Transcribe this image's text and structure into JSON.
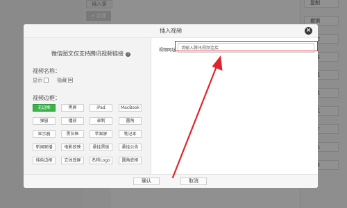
{
  "background": {
    "top_button": "插入录",
    "new_button": "+ 新建",
    "side_buttons": [
      "复制",
      "撤销",
      "清空",
      "本格",
      "恢复",
      "预览",
      "手机",
      "同步",
      "导出",
      "保存"
    ]
  },
  "modal": {
    "title": "插入视频",
    "close_icon": "close-icon",
    "notice": "微信图文仅支持腾讯视频链接",
    "help_icon": "?",
    "video_name_label": "视频名称：",
    "show_label": "显示",
    "hide_label": "隐藏",
    "show_checked": false,
    "hide_checked": true,
    "border_label": "视频边框：",
    "border_styles": [
      [
        "无边框",
        "黑屏",
        "iPad",
        "MacBook"
      ],
      [
        "弹窗",
        "播放",
        "录制",
        "圆角"
      ],
      [
        "显示器",
        "黑灰框",
        "苹果屏",
        "笔记本"
      ],
      [
        "新闻联播",
        "电影放映",
        "悬挂黑板",
        "悬挂公告"
      ],
      [
        "纯色边框",
        "立体遥屏",
        "名称Logo",
        "圆角底框"
      ]
    ],
    "selected_border": "无边框",
    "url_label": "视频网址",
    "url_placeholder": "请输入腾讯视频连接",
    "url_value": "",
    "confirm_label": "确认",
    "cancel_label": "取消"
  },
  "annotation": {
    "color": "#e0242c"
  },
  "colors": {
    "accent_green": "#3bb24a"
  }
}
